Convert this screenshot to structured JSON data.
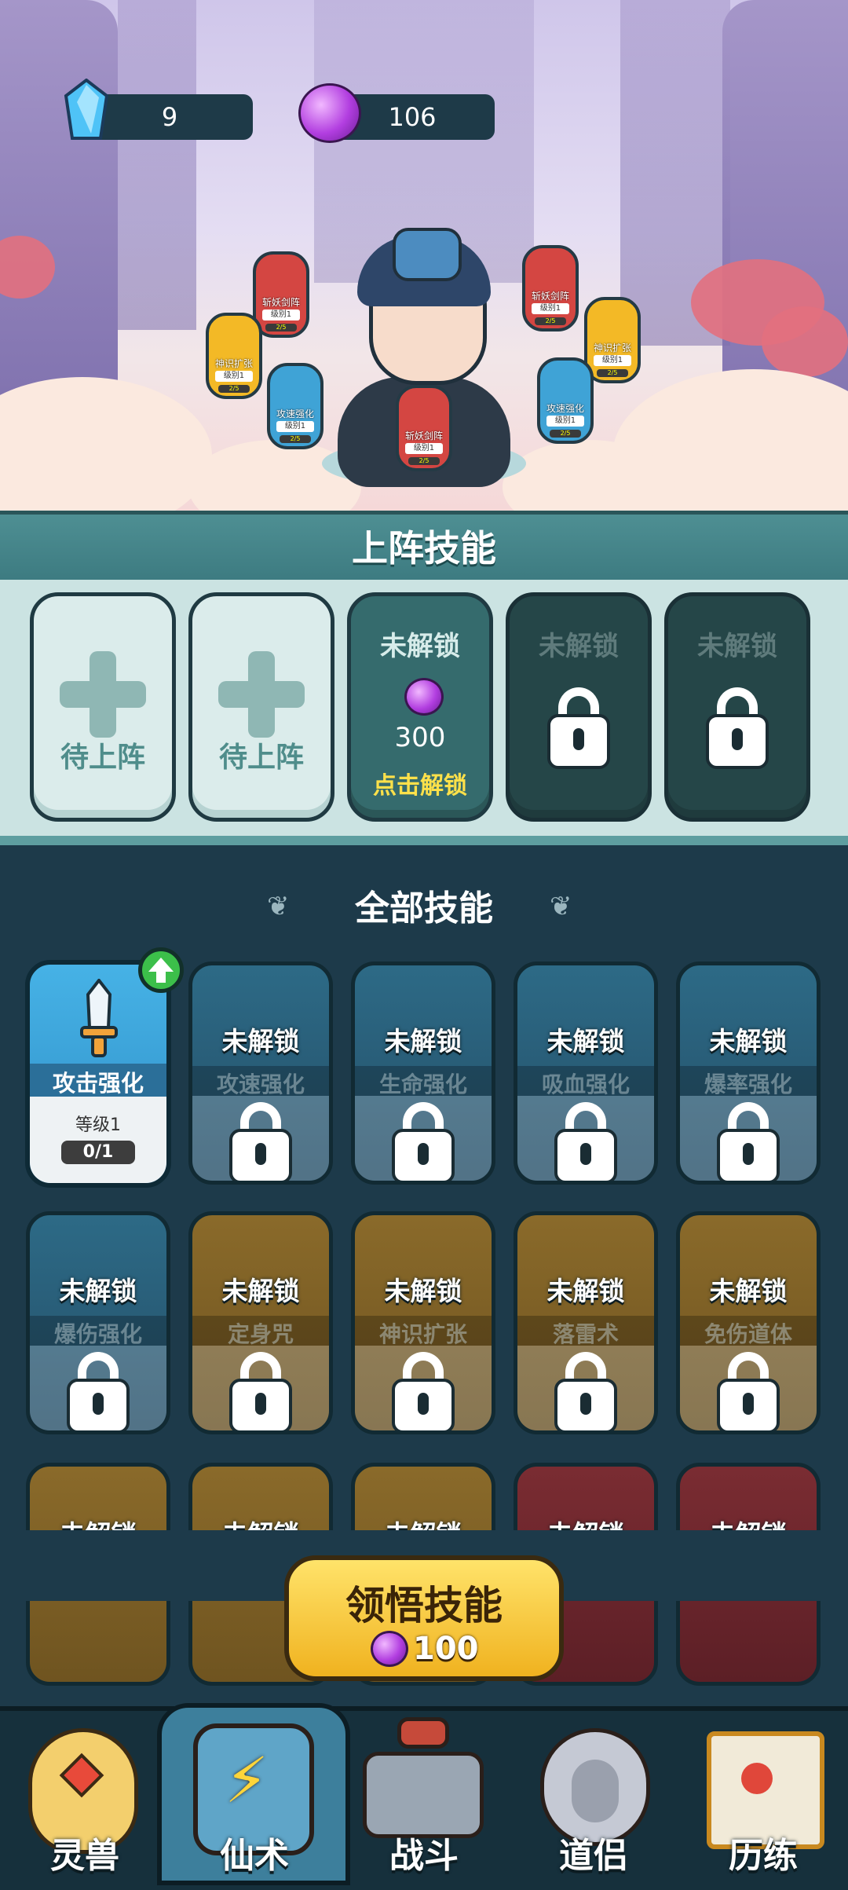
{
  "resources": {
    "crystal": {
      "icon": "blue-crystal-icon",
      "value": "9"
    },
    "gem": {
      "icon": "purple-gem-icon",
      "value": "106"
    }
  },
  "equipped": {
    "title": "上阵技能",
    "slots": [
      {
        "state": "empty",
        "label": "待上阵"
      },
      {
        "state": "empty",
        "label": "待上阵"
      },
      {
        "state": "unlockable",
        "label": "未解锁",
        "cost": "300",
        "action": "点击解锁"
      },
      {
        "state": "locked",
        "label": "未解锁"
      },
      {
        "state": "locked",
        "label": "未解锁"
      }
    ]
  },
  "all_skills": {
    "title": "全部技能",
    "first": {
      "name": "攻击强化",
      "level": "等级1",
      "progress": "0/1"
    },
    "locked_label": "未解锁",
    "row1": [
      "攻速强化",
      "生命强化",
      "吸血强化",
      "爆率强化"
    ],
    "row2": [
      "爆伤强化",
      "定身咒",
      "神识扩张",
      "落雷术",
      "免伤道体"
    ],
    "row3_label": "未解锁"
  },
  "learn": {
    "label": "领悟技能",
    "cost": "100"
  },
  "nav": [
    {
      "label": "灵兽",
      "icon": "egg-icon"
    },
    {
      "label": "仙术",
      "icon": "spell-card-icon"
    },
    {
      "label": "战斗",
      "icon": "battle-icon"
    },
    {
      "label": "道侣",
      "icon": "companion-icon"
    },
    {
      "label": "历练",
      "icon": "scroll-icon"
    }
  ],
  "mini_skills": [
    {
      "name": "斩妖剑阵",
      "level": "级别1",
      "prog": "2/5"
    },
    {
      "name": "斩妖剑阵",
      "level": "级别1",
      "prog": "2/5"
    },
    {
      "name": "神识扩张",
      "level": "级别1",
      "prog": "2/5"
    },
    {
      "name": "神识扩张",
      "level": "级别1",
      "prog": "2/5"
    },
    {
      "name": "攻速强化",
      "level": "级别1",
      "prog": "2/5"
    },
    {
      "name": "攻速强化",
      "level": "级别1",
      "prog": "2/5"
    },
    {
      "name": "斩妖剑阵",
      "level": "级别1",
      "prog": "2/5"
    }
  ],
  "colors": {
    "bg": "#1d3a4a",
    "teal_header": "#4e8f93",
    "button_gold": "#f0b21f",
    "unlock_text": "#ffe14a",
    "upgrade_green": "#3cbf4a"
  }
}
